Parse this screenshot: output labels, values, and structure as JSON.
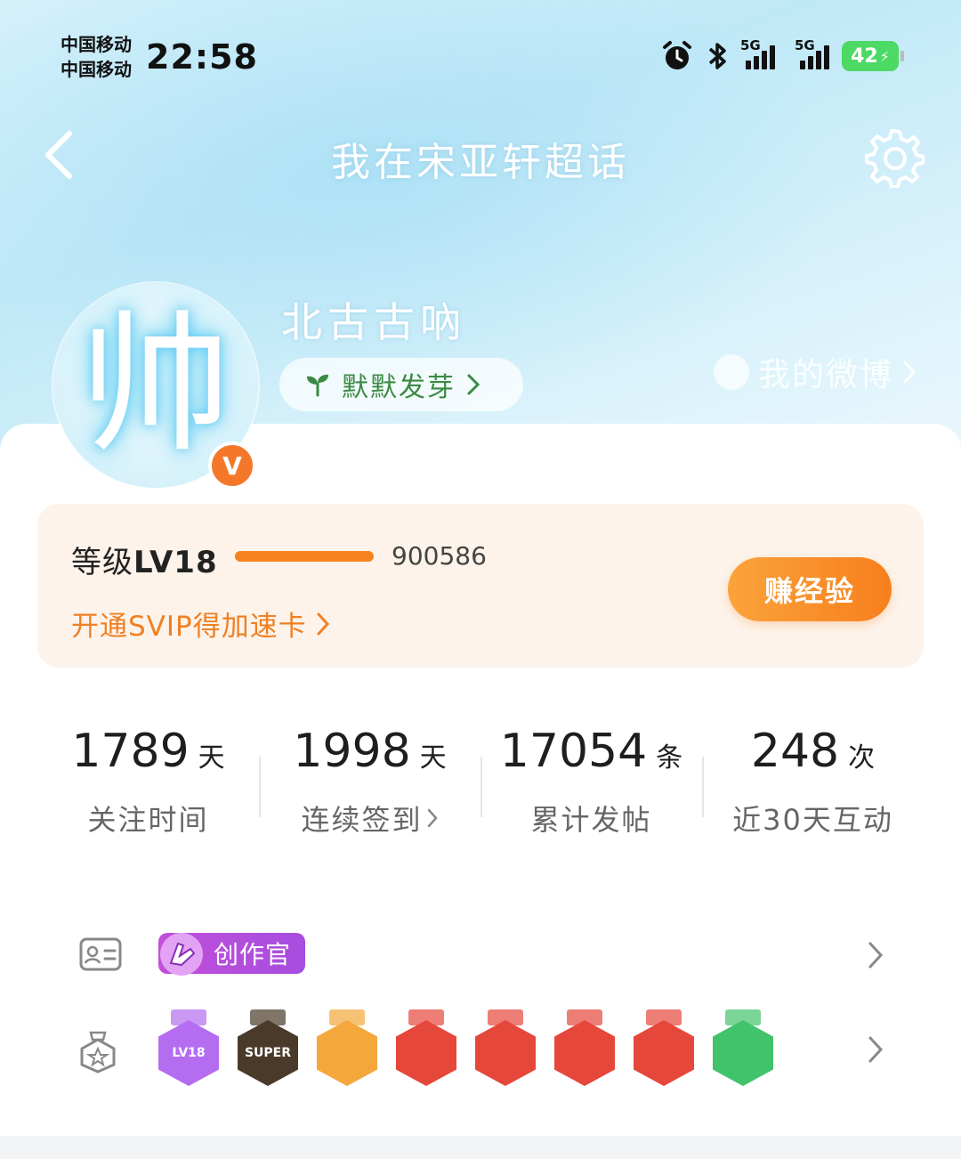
{
  "status_bar": {
    "carrier_1": "中国移动",
    "carrier_2": "中国移动",
    "time": "22:58",
    "network_1": "5G",
    "network_2": "5G",
    "battery": "42"
  },
  "nav": {
    "title": "我在宋亚轩超话"
  },
  "profile": {
    "avatar_glyph": "帅",
    "verified_badge": "V",
    "username": "北古古吶",
    "tag": "默默发芽",
    "my_weibo": "我的微博"
  },
  "level": {
    "label_prefix": "等级",
    "level": "LV18",
    "exp": "900586",
    "progress_fraction": 1.0,
    "svip_link": "开通SVIP得加速卡",
    "earn_button": "赚经验"
  },
  "stats": [
    {
      "value": "1789",
      "unit": "天",
      "label": "关注时间"
    },
    {
      "value": "1998",
      "unit": "天",
      "label": "连续签到"
    },
    {
      "value": "17054",
      "unit": "条",
      "label": "累计发帖"
    },
    {
      "value": "248",
      "unit": "次",
      "label": "近30天互动"
    }
  ],
  "badges": {
    "creator_label": "创作官",
    "medals": [
      {
        "name": "lv18-medal",
        "text": "LV18",
        "color": "#b46df0"
      },
      {
        "name": "super-medal",
        "text": "SUPER",
        "color": "#4a3a2a"
      },
      {
        "name": "crown-medal",
        "text": "",
        "color": "#f4a73b"
      },
      {
        "name": "zodiac-medal-1",
        "text": "",
        "color": "#e6473b"
      },
      {
        "name": "zodiac-medal-2",
        "text": "",
        "color": "#e6473b"
      },
      {
        "name": "zodiac-medal-3",
        "text": "",
        "color": "#e6473b"
      },
      {
        "name": "zodiac-medal-4",
        "text": "",
        "color": "#e6473b"
      },
      {
        "name": "hand-medal",
        "text": "",
        "color": "#41c36b"
      }
    ]
  },
  "colors": {
    "accent_orange": "#f5841f",
    "level_card_bg": "#fdf3ea",
    "creator_purple": "#b04fdc",
    "sprout_green": "#3b8a43"
  }
}
